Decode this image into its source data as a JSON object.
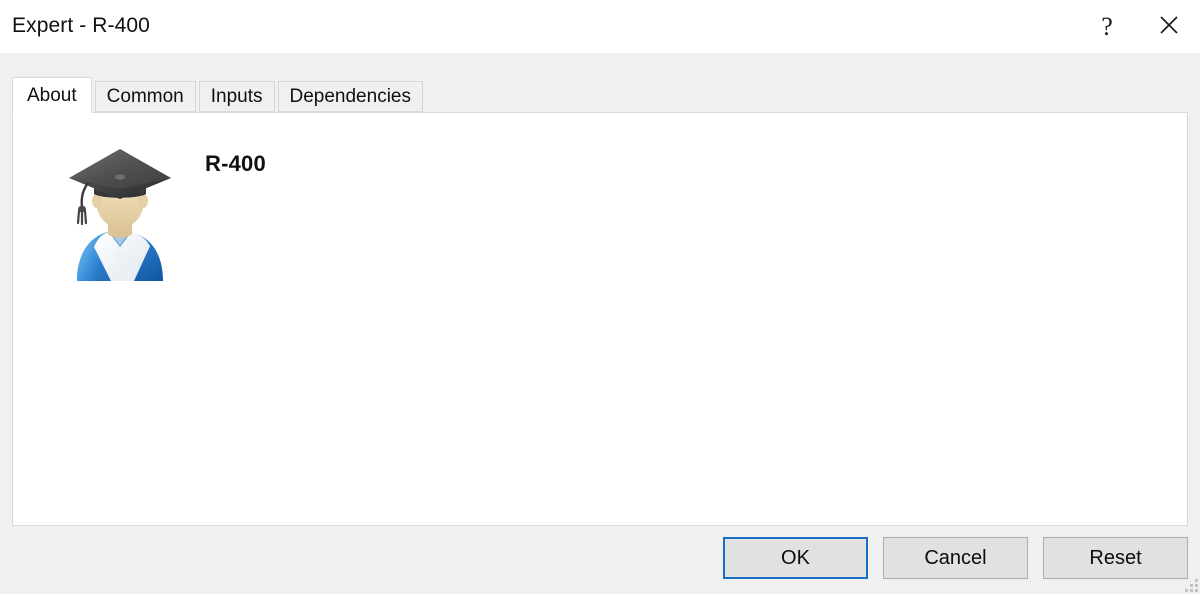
{
  "window": {
    "title": "Expert - R-400",
    "help_label": "?",
    "close_label": "✕",
    "help_icon": "question-mark-icon",
    "close_icon": "close-x-icon",
    "resize_grip_icon": "resize-grip-icon",
    "background_color": "#f0f0f0",
    "titlebar_color": "#ffffff"
  },
  "tabs": [
    {
      "label": "About",
      "active": true
    },
    {
      "label": "Common",
      "active": false
    },
    {
      "label": "Inputs",
      "active": false
    },
    {
      "label": "Dependencies",
      "active": false
    }
  ],
  "about": {
    "program_name": "R-400",
    "icon": "expert-advisor-graduate-avatar-icon",
    "icon_colors": {
      "cap": "#3f3f3f",
      "cap_highlight": "#6e6e6e",
      "face": "#ecd9b0",
      "body": "#1f6fc4",
      "body_highlight": "#4a9ee0",
      "shirt": "#f2f5f8"
    },
    "panel_background": "#ffffff",
    "panel_border": "#d9d9d9"
  },
  "footer": {
    "buttons": [
      {
        "label": "OK",
        "default": true
      },
      {
        "label": "Cancel",
        "default": false
      },
      {
        "label": "Reset",
        "default": false
      }
    ],
    "default_border_color": "#1a6fc4",
    "button_face_color": "#e1e1e1",
    "button_border_color": "#adadad"
  }
}
